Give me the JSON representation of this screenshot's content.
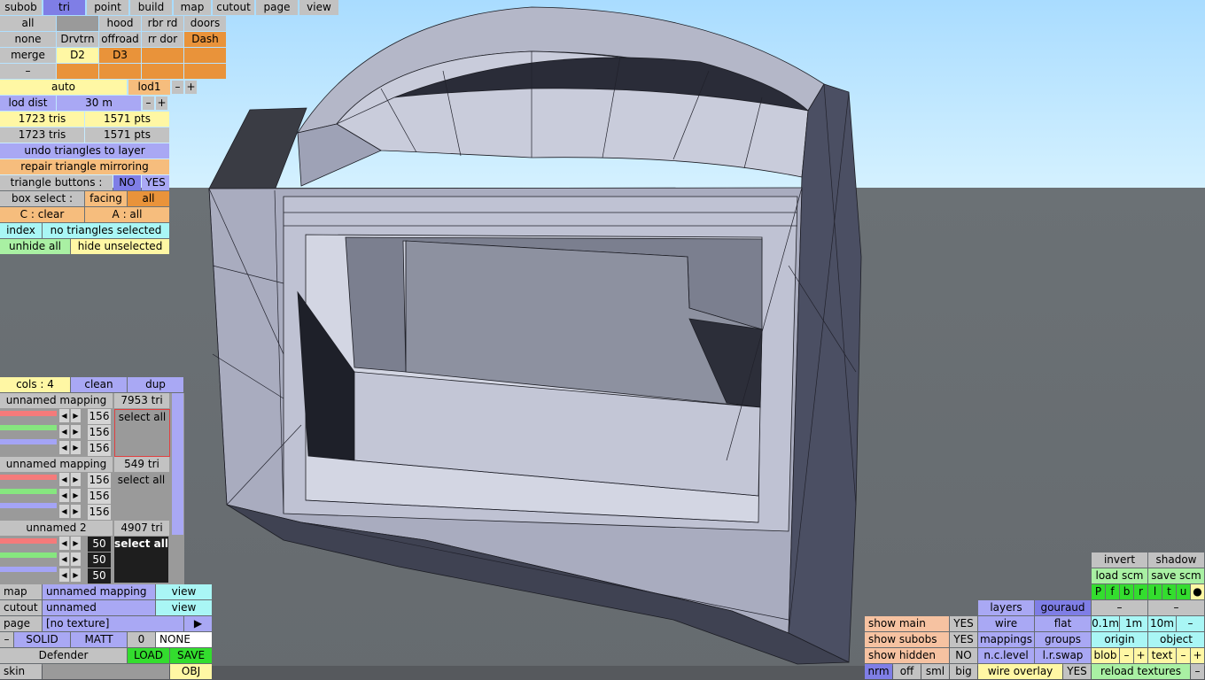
{
  "top_tabs": [
    "subob",
    "tri",
    "point",
    "build",
    "map",
    "cutout",
    "page",
    "view"
  ],
  "subob_grid": {
    "row1": [
      "all",
      "",
      "hood",
      "rbr rd",
      "doors"
    ],
    "row2": [
      "none",
      "Drvtrn",
      "offroad",
      "rr dor",
      "Dash"
    ],
    "row3": [
      "merge",
      "D2",
      "D3",
      "",
      ""
    ],
    "row4": [
      "–",
      "",
      "",
      "",
      ""
    ]
  },
  "lod": {
    "auto": "auto",
    "lod": "lod1",
    "minus": "–",
    "plus": "+",
    "dist_label": "lod dist",
    "dist_value": "30 m"
  },
  "stats": {
    "tris1": "1723 tris",
    "pts1": "1571 pts",
    "tris2": "1723 tris",
    "pts2": "1571 pts"
  },
  "actions": {
    "undo": "undo triangles to layer",
    "repair": "repair triangle mirroring",
    "tri_buttons": "triangle buttons :",
    "no": "NO",
    "yes": "YES",
    "box_select": "box select :",
    "facing": "facing",
    "all": "all",
    "clear": "C : clear",
    "a_all": "A : all",
    "index": "index",
    "no_sel": "no triangles selected",
    "unhide": "unhide all",
    "hide_unsel": "hide unselected"
  },
  "cols": {
    "label": "cols : 4",
    "clean": "clean",
    "dup": "dup"
  },
  "mappings": [
    {
      "name": "unnamed mapping",
      "count": "7953 tri",
      "values": [
        "156",
        "156",
        "156"
      ],
      "select": "select all"
    },
    {
      "name": "unnamed mapping",
      "count": "549 tri",
      "values": [
        "156",
        "156",
        "156"
      ],
      "select": "select all"
    },
    {
      "name": "unnamed 2",
      "count": "4907 tri",
      "values": [
        "50",
        "50",
        "50"
      ],
      "select": "select all"
    }
  ],
  "bottom_left": {
    "map": "map",
    "map_val": "unnamed mapping",
    "view": "view",
    "cutout": "cutout",
    "cutout_val": "unnamed",
    "view2": "view",
    "page": "page",
    "page_val": "[no texture]",
    "play": "▶",
    "minus": "–",
    "solid": "SOLID",
    "matt": "MATT",
    "zero": "0",
    "none": "NONE",
    "defender": "Defender",
    "load": "LOAD",
    "save": "SAVE",
    "skin": "skin",
    "obj": "OBJ"
  },
  "bottom_right": {
    "invert": "invert",
    "shadow": "shadow",
    "load_scm": "load scm",
    "save_scm": "save scm",
    "letters": [
      "P",
      "f",
      "b",
      "r",
      "l",
      "t",
      "u",
      "●"
    ],
    "layers": "layers",
    "gouraud": "gouraud",
    "dash1": "–",
    "dash2": "–",
    "show_main": "show main",
    "show_main_v": "YES",
    "wire": "wire",
    "flat": "flat",
    "m01": "0.1m",
    "m1": "1m",
    "m10": "10m",
    "mdash": "–",
    "show_subobs": "show subobs",
    "show_subobs_v": "YES",
    "mappings": "mappings",
    "groups": "groups",
    "origin": "origin",
    "object": "object",
    "show_hidden": "show hidden",
    "show_hidden_v": "NO",
    "nc_level": "n.c.level",
    "lr_swap": "l.r.swap",
    "blob": "blob",
    "bm": "–",
    "bp": "+",
    "text": "text",
    "tm": "–",
    "tp": "+",
    "nrm": "nrm",
    "off": "off",
    "sml": "sml",
    "big": "big",
    "wire_overlay": "wire overlay",
    "wo_v": "YES",
    "reload": "reload textures",
    "rdash": "–"
  },
  "colors": {
    "sky": "#b9e6ff",
    "ground": "#6c7276",
    "mesh": "#8e92a6"
  }
}
